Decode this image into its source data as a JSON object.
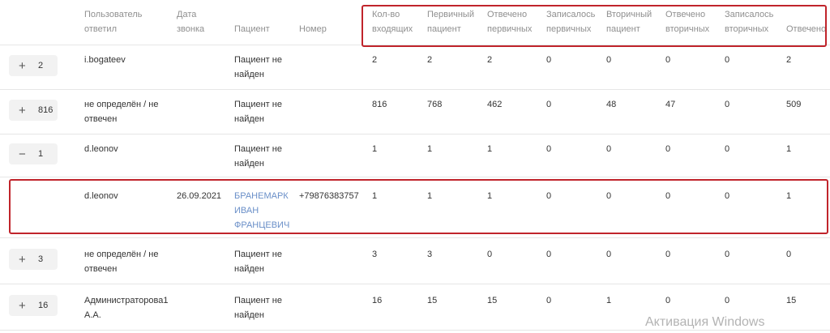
{
  "header": {
    "user_answered": "Пользователь\nответил",
    "call_date": "Дата\nзвонка",
    "patient": "Пациент",
    "number": "Номер",
    "incoming": "Кол-во\nвходящих",
    "primary_patient": "Первичный\nпациент",
    "answered_primary": "Отвечено\nпервичных",
    "booked_primary": "Записалось\nпервичных",
    "secondary_patient": "Вторичный\nпациент",
    "answered_secondary": "Отвечено\nвторичных",
    "booked_secondary": "Записалось\nвторичных",
    "answered": "Отвечено"
  },
  "rows": [
    {
      "expand_sign": "+",
      "count": "2",
      "user": "i.bogateev",
      "date": "",
      "patient": "Пациент не\nнайден",
      "number": "",
      "incoming": "2",
      "primary": "2",
      "answered_primary": "2",
      "booked_primary": "0",
      "secondary": "0",
      "answered_secondary": "0",
      "booked_secondary": "0",
      "answered": "2"
    },
    {
      "expand_sign": "+",
      "count": "816",
      "user": "не определён / не\nотвечен",
      "date": "",
      "patient": "Пациент не\nнайден",
      "number": "",
      "incoming": "816",
      "primary": "768",
      "answered_primary": "462",
      "booked_primary": "0",
      "secondary": "48",
      "answered_secondary": "47",
      "booked_secondary": "0",
      "answered": "509"
    },
    {
      "expand_sign": "−",
      "count": "1",
      "user": "d.leonov",
      "date": "",
      "patient": "Пациент не\nнайден",
      "number": "",
      "incoming": "1",
      "primary": "1",
      "answered_primary": "1",
      "booked_primary": "0",
      "secondary": "0",
      "answered_secondary": "0",
      "booked_secondary": "0",
      "answered": "1"
    },
    {
      "expand_sign": "",
      "count": "",
      "user": "d.leonov",
      "date": "26.09.2021",
      "patient": "БРАНЕМАРК\nИВАН\nФРАНЦЕВИЧ",
      "number": "+79876383757",
      "incoming": "1",
      "primary": "1",
      "answered_primary": "1",
      "booked_primary": "0",
      "secondary": "0",
      "answered_secondary": "0",
      "booked_secondary": "0",
      "answered": "1"
    },
    {
      "expand_sign": "+",
      "count": "3",
      "user": "не определён / не\nотвечен",
      "date": "",
      "patient": "Пациент не\nнайден",
      "number": "",
      "incoming": "3",
      "primary": "3",
      "answered_primary": "0",
      "booked_primary": "0",
      "secondary": "0",
      "answered_secondary": "0",
      "booked_secondary": "0",
      "answered": "0"
    },
    {
      "expand_sign": "+",
      "count": "16",
      "user": "Администраторова1\nА.А.",
      "date": "",
      "patient": "Пациент не\nнайден",
      "number": "",
      "incoming": "16",
      "primary": "15",
      "answered_primary": "15",
      "booked_primary": "0",
      "secondary": "1",
      "answered_secondary": "0",
      "booked_secondary": "0",
      "answered": "15"
    }
  ],
  "watermark": "Активация Windows",
  "colors": {
    "highlight": "#c0242b",
    "link": "#6a8fc8",
    "header_text": "#8f8f8f"
  }
}
